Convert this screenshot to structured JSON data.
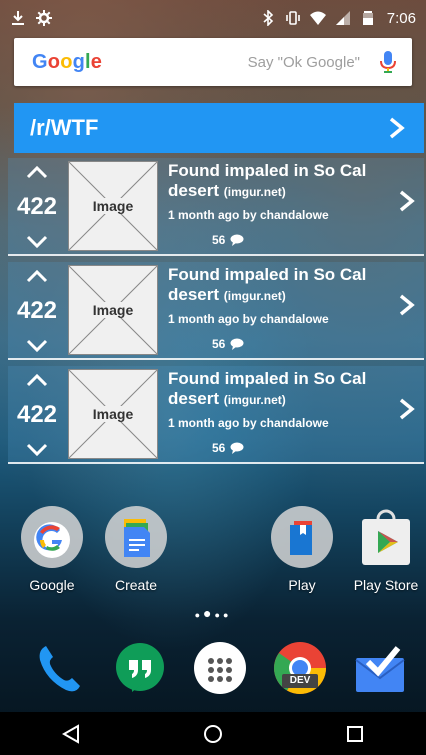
{
  "status_bar": {
    "time": "7:06",
    "icons": [
      "download-icon",
      "settings-icon",
      "bluetooth-icon",
      "vibrate-icon",
      "wifi-icon",
      "signal-icon",
      "battery-icon"
    ]
  },
  "search_bar": {
    "logo_text": "Google",
    "hint": "Say \"Ok Google\"",
    "icon": "mic-icon"
  },
  "widget": {
    "subreddit": "/r/WTF",
    "posts": [
      {
        "score": "422",
        "thumbnail_label": "Image",
        "title": "Found impaled in So Cal desert",
        "domain": "(imgur.net)",
        "meta": "1 month ago by chandalowe",
        "comments": "56"
      },
      {
        "score": "422",
        "thumbnail_label": "Image",
        "title": "Found impaled in So Cal desert",
        "domain": "(imgur.net)",
        "meta": "1 month ago by chandalowe",
        "comments": "56"
      },
      {
        "score": "422",
        "thumbnail_label": "Image",
        "title": "Found impaled in So Cal desert",
        "domain": "(imgur.net)",
        "meta": "1 month ago by chandalowe",
        "comments": "56"
      }
    ]
  },
  "apps": [
    {
      "label": "Google",
      "icon": "google-folder-icon"
    },
    {
      "label": "Create",
      "icon": "docs-folder-icon"
    },
    {
      "label": "Play",
      "icon": "play-folder-icon"
    },
    {
      "label": "Play Store",
      "icon": "play-store-icon"
    }
  ],
  "dock": [
    {
      "icon": "phone-icon"
    },
    {
      "icon": "hangouts-icon"
    },
    {
      "icon": "app-drawer-icon"
    },
    {
      "icon": "chrome-dev-icon",
      "badge": "DEV"
    },
    {
      "icon": "inbox-icon"
    }
  ],
  "nav": [
    "back-icon",
    "home-icon",
    "recents-icon"
  ],
  "colors": {
    "widget_header": "#2196f3",
    "google_blue": "#4285f4",
    "google_red": "#ea4335",
    "google_yellow": "#fbbc05",
    "google_green": "#34a853"
  }
}
